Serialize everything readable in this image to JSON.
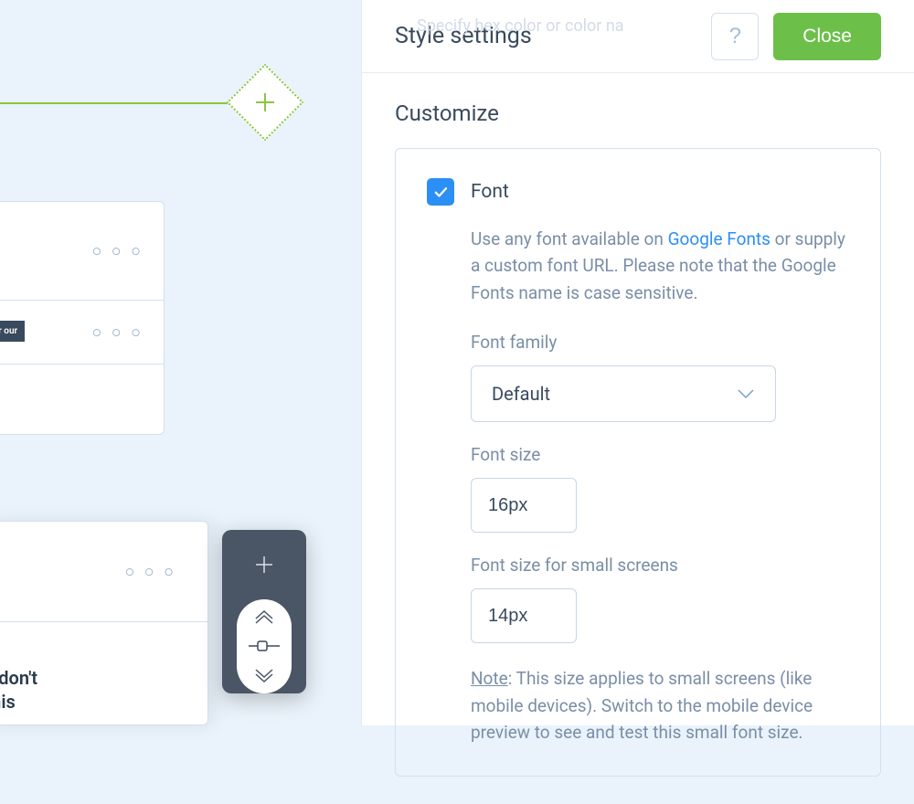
{
  "canvas": {
    "card1": {
      "badge_text": "for our"
    },
    "card2": {
      "text_line1": "you don't",
      "text_line2": "at this"
    }
  },
  "panel": {
    "ghost_input": "Specify hex color or color na",
    "title": "Style settings",
    "help_label": "?",
    "close_label": "Close",
    "section_title": "Customize",
    "font": {
      "checkbox_label": "Font",
      "description_pre": "Use any font available on ",
      "description_link": "Google Fonts",
      "description_post": " or supply a custom font URL. Please note that the Google Fonts name is case sensitive.",
      "family_label": "Font family",
      "family_value": "Default",
      "size_label": "Font size",
      "size_value": "16px",
      "size_small_label": "Font size for small screens",
      "size_small_value": "14px",
      "note_label": "Note",
      "note_text": ": This size applies to small screens (like mobile devices). Switch to the mobile device preview to see and test this small font size."
    }
  }
}
